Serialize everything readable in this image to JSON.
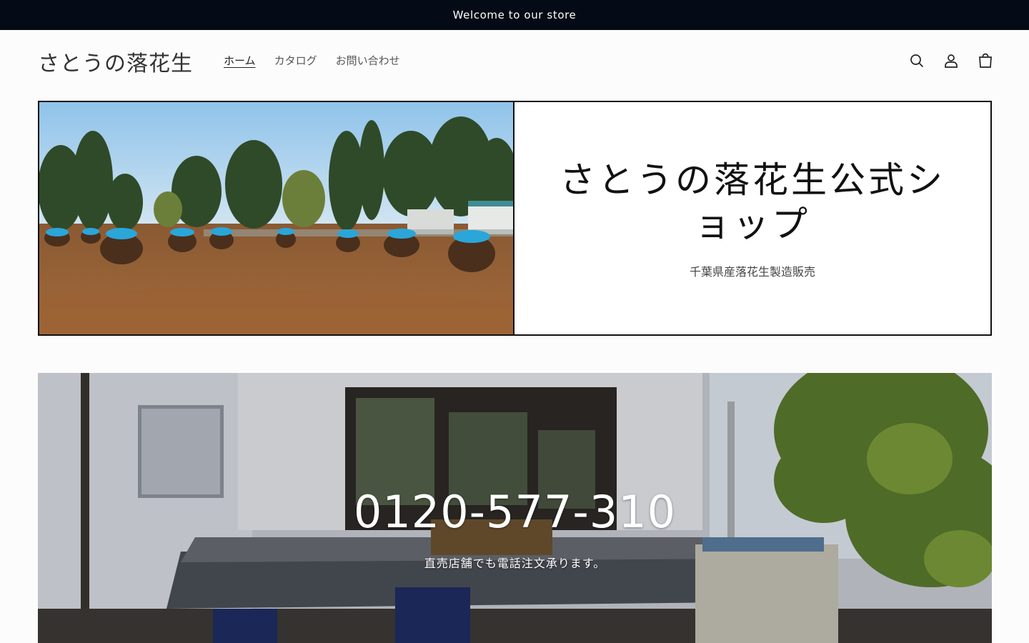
{
  "announcement": {
    "text": "Welcome to our store"
  },
  "header": {
    "logo": "さとうの落花生",
    "nav": [
      {
        "label": "ホーム",
        "active": true
      },
      {
        "label": "カタログ",
        "active": false
      },
      {
        "label": "お問い合わせ",
        "active": false
      }
    ],
    "icons": [
      "search-icon",
      "account-icon",
      "cart-icon"
    ]
  },
  "banner": {
    "title": "さとうの落花生公式ショップ",
    "subtitle": "千葉県産落花生製造販売",
    "image": "peanut-field-photo"
  },
  "hero": {
    "phone": "0120-577-310",
    "subtitle": "直売店舗でも電話注文承ります。",
    "image": "shop-building-photo"
  },
  "colors": {
    "announcement_bg": "#050b16",
    "page_bg": "#fcfcfc",
    "text": "#222222"
  }
}
